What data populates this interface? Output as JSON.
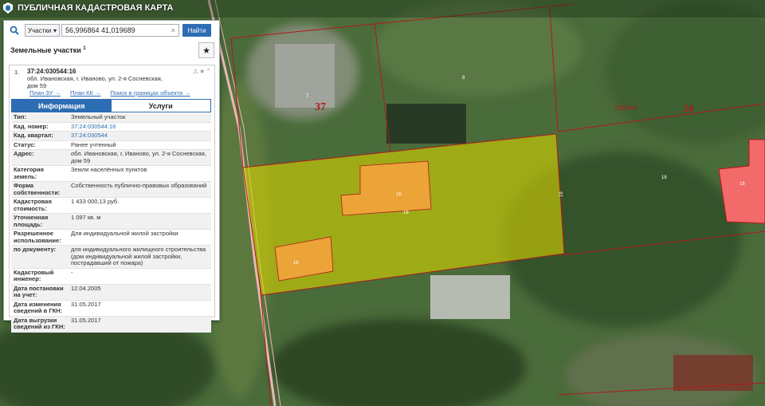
{
  "header": {
    "title": "ПУБЛИЧНАЯ КАДАСТРОВАЯ КАРТА"
  },
  "search": {
    "type": "Участки",
    "query": "56,996864 41,019689",
    "button": "Найти"
  },
  "results": {
    "title": "Земельные участки",
    "count": "1"
  },
  "parcel": {
    "index": "1.",
    "id": "37:24:030544:16",
    "address": "обл. Ивановская, г. Иваново, ул. 2-я Сосневская, дом 59",
    "links": [
      "План ЗУ →",
      "План КК →",
      "Поиск в границах объекта →"
    ],
    "tabs": [
      "Информация",
      "Услуги"
    ],
    "rows": [
      {
        "k": "Тип:",
        "v": "Земельный участок"
      },
      {
        "k": "Кад. номер:",
        "v": "37:24:030544:16"
      },
      {
        "k": "Кад. квартал:",
        "v": "37:24:030544"
      },
      {
        "k": "Статус:",
        "v": "Ранее учтенный"
      },
      {
        "k": "Адрес:",
        "v": "обл. Ивановская, г. Иваново, ул. 2-я Сосневская, дом 59"
      },
      {
        "k": "Категория земель:",
        "v": "Земли населённых пунктов"
      },
      {
        "k": "Форма собственности:",
        "v": "Собственность публично-правовых образований"
      },
      {
        "k": "Кадастровая стоимость:",
        "v": "1 433 000,13 руб."
      },
      {
        "k": "Уточненная площадь:",
        "v": "1 097 кв. м"
      },
      {
        "k": "Разрешенное использование:",
        "v": "Для индивидуальной жилой застройки"
      },
      {
        "k": "по документу:",
        "v": "для индивидуального жилищного строительства (дом индивидуальной жилой застройки, пострадавший от пожара)"
      },
      {
        "k": "Кадастровый инженер:",
        "v": "-"
      },
      {
        "k": "Дата постановки на учет:",
        "v": "12.04.2005"
      },
      {
        "k": "Дата изменения сведений в ГКН:",
        "v": "31.05.2017"
      },
      {
        "k": "Дата выгрузки сведений из ГКН:",
        "v": "31.05.2017"
      }
    ]
  },
  "map_labels": {
    "quarter_37": "37",
    "quarter_24": "24",
    "block": "030544",
    "lbl_7": "7",
    "lbl_8": "8",
    "lbl_16a": "16",
    "lbl_16b": "16",
    "lbl_16c": "16",
    "lbl_18": "18",
    "lbl_18b": "18",
    "lbl_19": "19"
  },
  "colors": {
    "accent": "#2d6db3",
    "parcel_fill": "#d8d400",
    "building": "#f4a23c",
    "highlight": "#f26a6a"
  }
}
